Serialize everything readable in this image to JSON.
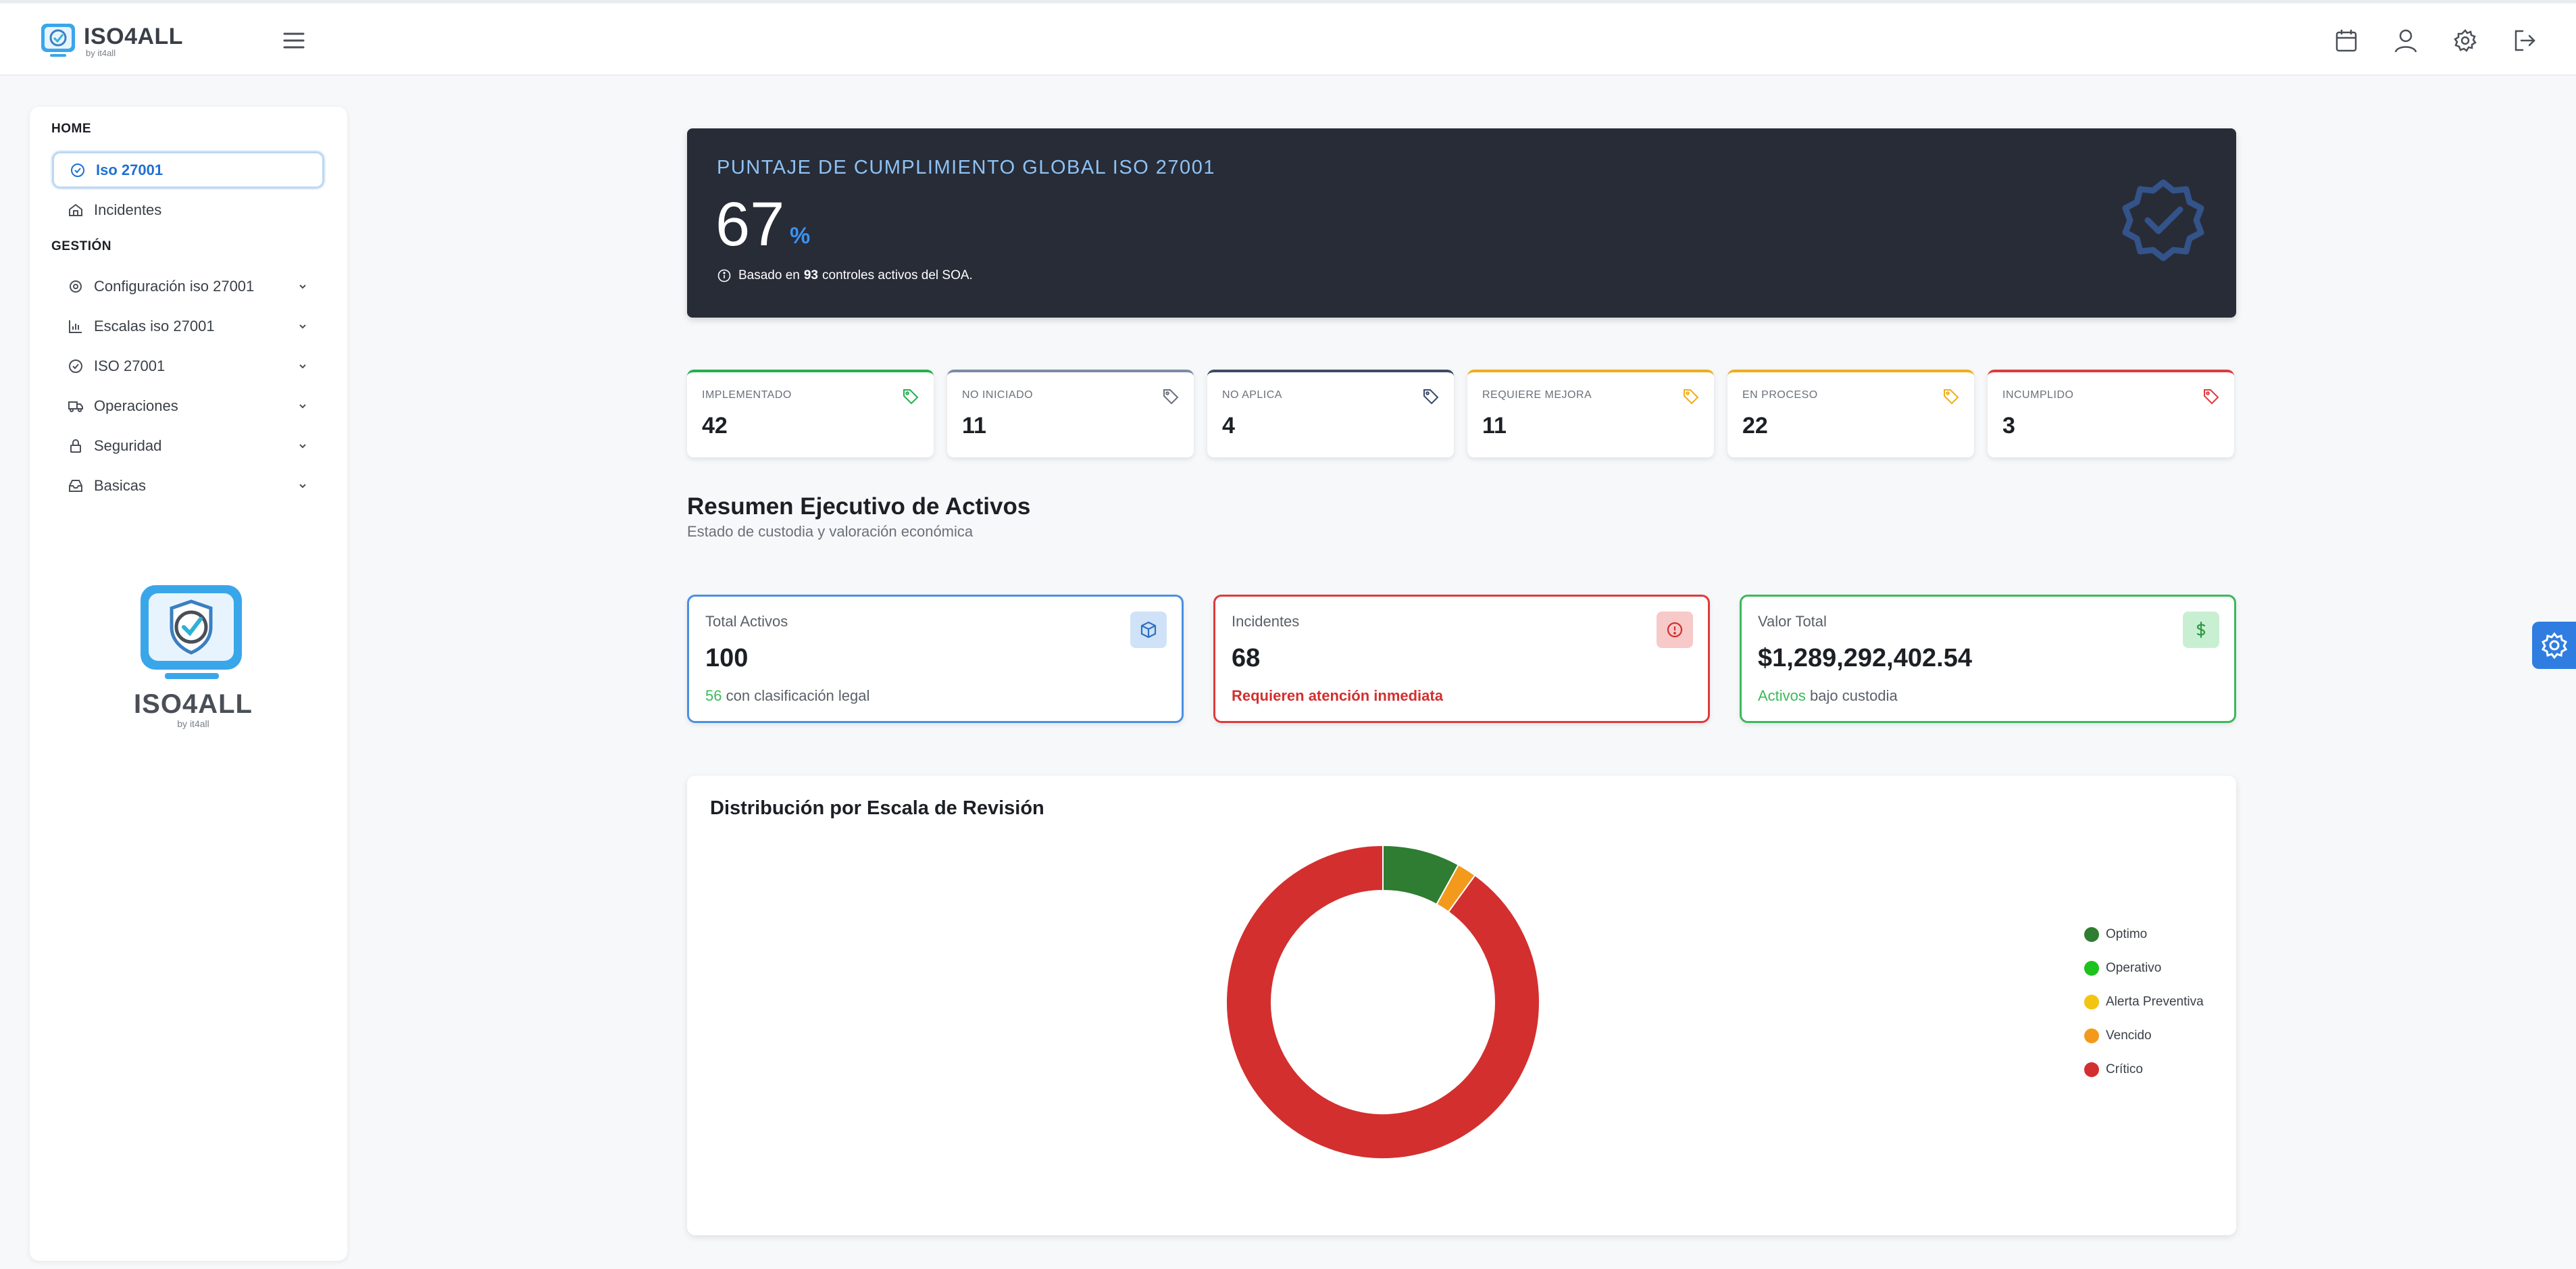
{
  "brand": {
    "name": "ISO4ALL",
    "sub": "by it4all"
  },
  "sidebar": {
    "sections": [
      "HOME",
      "GESTIÓN"
    ],
    "home_items": [
      {
        "label": "Iso 27001",
        "icon": "check-circle-icon",
        "active": true
      },
      {
        "label": "Incidentes",
        "icon": "home-icon"
      }
    ],
    "gestion_items": [
      {
        "label": "Configuración iso 27001",
        "icon": "gear-icon"
      },
      {
        "label": "Escalas iso 27001",
        "icon": "bar-chart-icon"
      },
      {
        "label": "ISO 27001",
        "icon": "check-circle-icon"
      },
      {
        "label": "Operaciones",
        "icon": "truck-icon"
      },
      {
        "label": "Seguridad",
        "icon": "lock-icon"
      },
      {
        "label": "Basicas",
        "icon": "inbox-icon"
      }
    ],
    "logo_text": "ISO4ALL",
    "logo_sub": "by it4all"
  },
  "hero": {
    "title": "PUNTAJE DE CUMPLIMIENTO GLOBAL ISO 27001",
    "value": "67",
    "unit": "%",
    "note_before": "Basado en",
    "note_count": "93",
    "note_after": "controles activos del SOA."
  },
  "stats": [
    {
      "label": "IMPLEMENTADO",
      "value": "42",
      "color": "#22b14c"
    },
    {
      "label": "NO INICIADO",
      "value": "11",
      "color": "#7b8ba6"
    },
    {
      "label": "NO APLICA",
      "value": "4",
      "color": "#3b4a66"
    },
    {
      "label": "REQUIERE MEJORA",
      "value": "11",
      "color": "#f0ad1a"
    },
    {
      "label": "EN PROCESO",
      "value": "22",
      "color": "#f0ad1a"
    },
    {
      "label": "INCUMPLIDO",
      "value": "3",
      "color": "#e03a3a"
    }
  ],
  "summary": {
    "title": "Resumen Ejecutivo de Activos",
    "subtitle": "Estado de custodia y valoración económica"
  },
  "asset_cards": {
    "total": {
      "label": "Total Activos",
      "value": "100",
      "foot_highlight": "56",
      "foot_text": "con clasificación legal",
      "color": "#4a90e2"
    },
    "incidents": {
      "label": "Incidentes",
      "value": "68",
      "foot_text": "Requieren atención inmediata",
      "color": "#e03a3a"
    },
    "value": {
      "label": "Valor Total",
      "value": "$1,289,292,402.54",
      "foot_highlight": "Activos",
      "foot_text": "bajo custodia",
      "color": "#3cb95a"
    }
  },
  "chart_data": {
    "type": "pie",
    "title": "Distribución por Escala de Revisión",
    "categories": [
      "Optimo",
      "Operativo",
      "Alerta Preventiva",
      "Vencido",
      "Crítico"
    ],
    "values": [
      8,
      0,
      0,
      2,
      90
    ],
    "colors": [
      "#2e7d32",
      "#1ec21e",
      "#f2c511",
      "#f39a1c",
      "#d32f2f"
    ],
    "legend": "right"
  }
}
